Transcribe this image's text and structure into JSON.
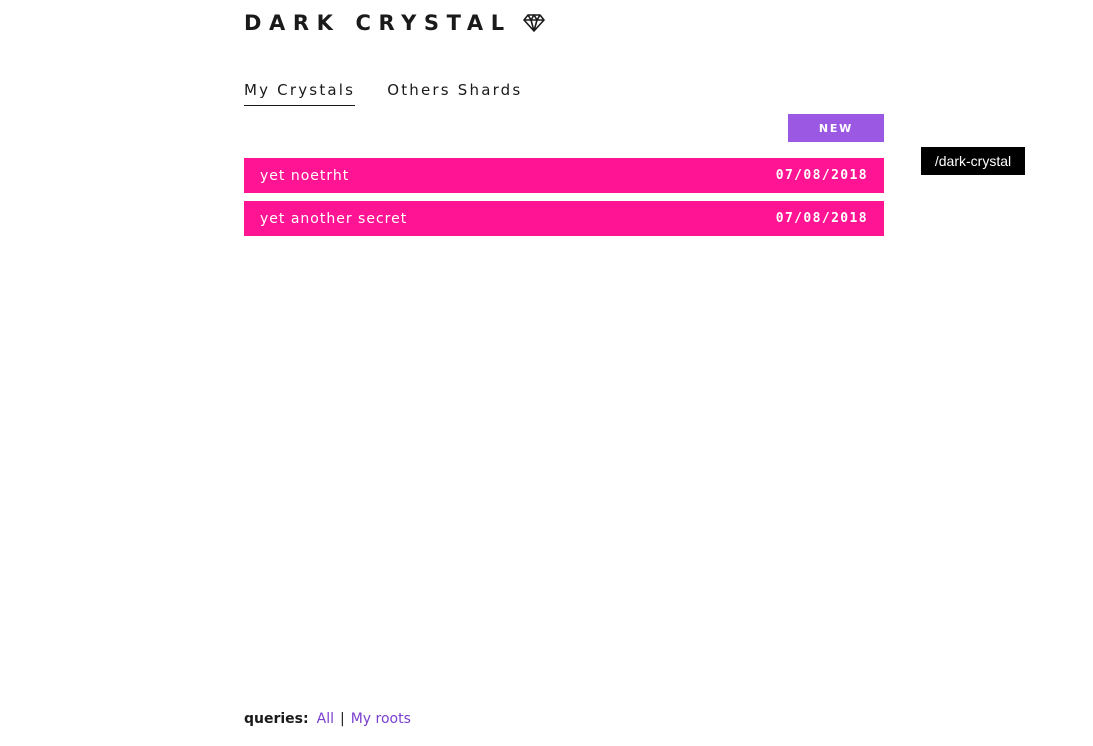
{
  "header": {
    "title": "DARK CRYSTAL",
    "icon": "gem-icon"
  },
  "tabs": [
    {
      "label": "My Crystals",
      "active": true
    },
    {
      "label": "Others Shards",
      "active": false
    }
  ],
  "toolbar": {
    "new_label": "NEW"
  },
  "crystals": [
    {
      "name": "yet noetrht",
      "date": "07/08/2018"
    },
    {
      "name": "yet another secret",
      "date": "07/08/2018"
    }
  ],
  "route_badge": "/dark-crystal",
  "footer": {
    "queries_label": "queries:",
    "links": [
      {
        "label": "All"
      },
      {
        "label": "My roots"
      }
    ],
    "separator": "|"
  },
  "colors": {
    "accent_pink": "#ff1493",
    "accent_purple": "#9b59e3",
    "link": "#7a3fcf"
  }
}
